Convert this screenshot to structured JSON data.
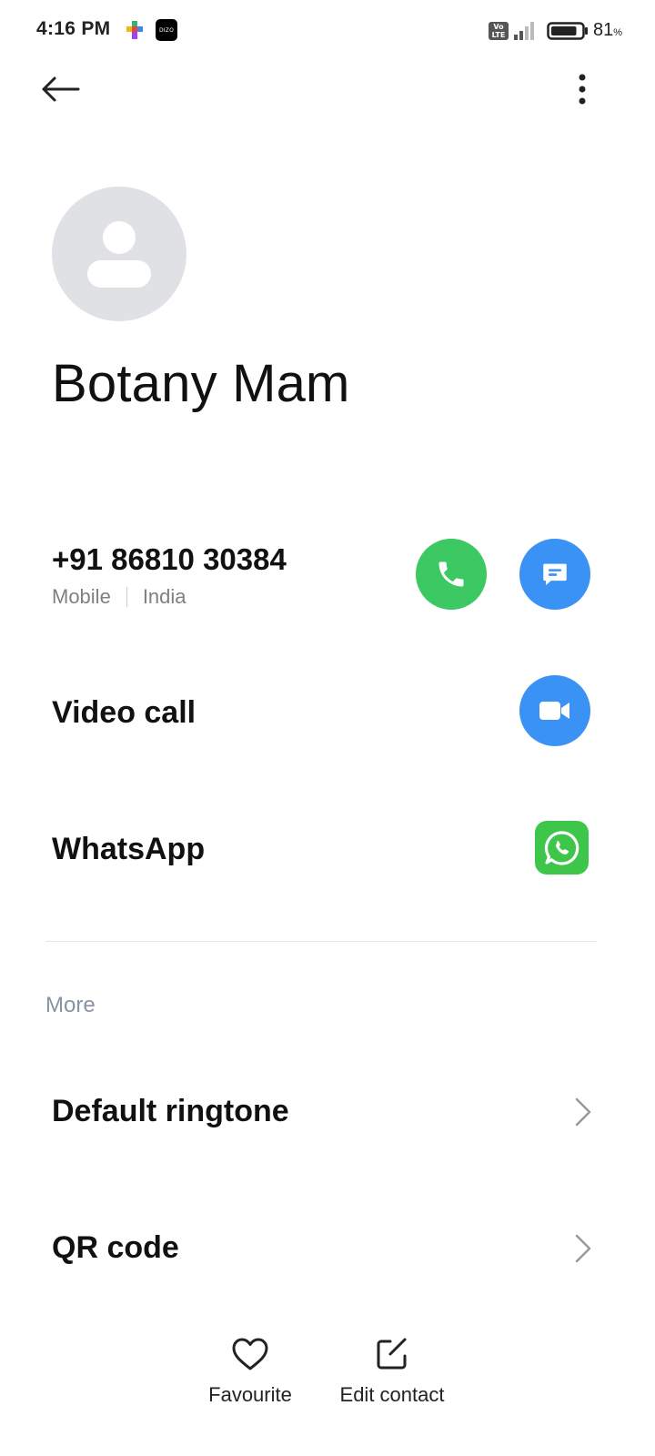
{
  "status_bar": {
    "time": "4:16 PM",
    "notification_icons": [
      "colorful-app-icon",
      "dizo-app-icon"
    ],
    "dizo_label": "DIZO",
    "volte_label_top": "Vo",
    "volte_label_bottom": "LTE",
    "battery_percent": "81",
    "battery_unit": "%",
    "battery_level": 0.81
  },
  "app_bar": {
    "back_icon": "arrow-left-icon",
    "more_icon": "more-vertical-icon"
  },
  "contact": {
    "avatar_icon": "person-placeholder-icon",
    "name": "Botany Mam"
  },
  "phone": {
    "number": "+91 86810 30384",
    "type": "Mobile",
    "region": "India",
    "call_icon": "phone-icon",
    "message_icon": "message-icon"
  },
  "video_call": {
    "label": "Video call",
    "icon": "video-camera-icon"
  },
  "whatsapp": {
    "label": "WhatsApp",
    "icon": "whatsapp-icon"
  },
  "more_section": {
    "heading": "More",
    "items": [
      {
        "label": "Default ringtone"
      },
      {
        "label": "QR code"
      }
    ]
  },
  "bottom_bar": {
    "favourite_label": "Favourite",
    "edit_label": "Edit contact"
  },
  "colors": {
    "call_green": "#3cc862",
    "action_blue": "#3a92f5",
    "whatsapp_green": "#3ec64a",
    "avatar_bg": "#dfe1e5",
    "section_heading": "#8a93a6"
  }
}
